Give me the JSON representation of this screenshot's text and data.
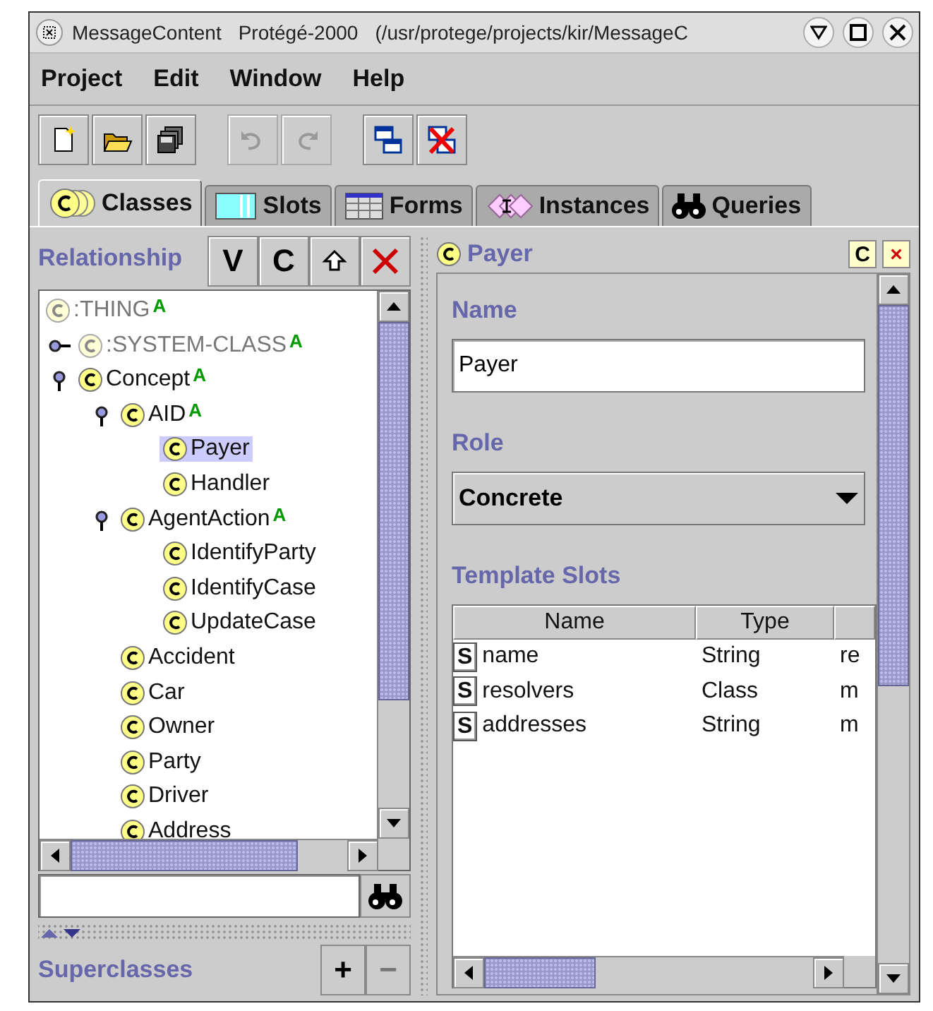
{
  "window": {
    "title_parts": [
      "MessageContent",
      "Protégé-2000",
      "(/usr/protege/projects/kir/MessageC"
    ]
  },
  "menu": [
    "Project",
    "Edit",
    "Window",
    "Help"
  ],
  "toolbar": [
    {
      "kind": "new",
      "disabled": false
    },
    {
      "kind": "open",
      "disabled": false
    },
    {
      "kind": "save",
      "disabled": false
    },
    {
      "kind": "undo",
      "disabled": true
    },
    {
      "kind": "redo",
      "disabled": true
    },
    {
      "kind": "add-window",
      "disabled": false
    },
    {
      "kind": "remove-window",
      "disabled": false
    }
  ],
  "tabs": [
    {
      "label": "Classes",
      "kind": "classes",
      "selected": true
    },
    {
      "label": "Slots",
      "kind": "slots",
      "selected": false
    },
    {
      "label": "Forms",
      "kind": "forms",
      "selected": false
    },
    {
      "label": "Instances",
      "kind": "instances",
      "selected": false
    },
    {
      "label": "Queries",
      "kind": "queries",
      "selected": false
    }
  ],
  "class_browser": {
    "title": "Relationship",
    "buttons": [
      {
        "kind": "text",
        "label": "V"
      },
      {
        "kind": "text",
        "label": "C"
      },
      {
        "kind": "up"
      },
      {
        "kind": "delete"
      }
    ],
    "tree": [
      {
        "name": ":THING",
        "system": true,
        "badge": "A",
        "selected": false,
        "children": [
          {
            "name": ":SYSTEM-CLASS",
            "system": true,
            "badge": "A",
            "selected": false,
            "expanded": false
          },
          {
            "name": "Concept",
            "system": false,
            "badge": "A",
            "selected": false,
            "expanded": true,
            "children": [
              {
                "name": "AID",
                "system": false,
                "badge": "A",
                "selected": false,
                "expanded": true,
                "children": [
                  {
                    "name": "Payer",
                    "system": false,
                    "selected": true
                  },
                  {
                    "name": "Handler",
                    "system": false,
                    "selected": false
                  }
                ]
              },
              {
                "name": "AgentAction",
                "system": false,
                "badge": "A",
                "selected": false,
                "expanded": true,
                "children": [
                  {
                    "name": "IdentifyParty",
                    "system": false,
                    "selected": false
                  },
                  {
                    "name": "IdentifyCase",
                    "system": false,
                    "selected": false
                  },
                  {
                    "name": "UpdateCase",
                    "system": false,
                    "selected": false
                  }
                ]
              },
              {
                "name": "Accident",
                "system": false,
                "selected": false
              },
              {
                "name": "Car",
                "system": false,
                "selected": false
              },
              {
                "name": "Owner",
                "system": false,
                "selected": false
              },
              {
                "name": "Party",
                "system": false,
                "selected": false
              },
              {
                "name": "Driver",
                "system": false,
                "selected": false
              },
              {
                "name": "Address",
                "system": false,
                "selected": false
              }
            ]
          }
        ]
      }
    ],
    "superclasses": {
      "title": "Superclasses",
      "buttons": [
        {
          "label": "+",
          "disabled": false
        },
        {
          "label": "−",
          "disabled": true
        }
      ]
    }
  },
  "class_form": {
    "title": "Payer",
    "buttons": [
      {
        "kind": "text",
        "label": "C"
      },
      {
        "kind": "close",
        "label": "×"
      }
    ],
    "name_label": "Name",
    "name_value": "Payer",
    "role_label": "Role",
    "role_value": "Concrete",
    "slots_label": "Template Slots",
    "columns": [
      "Name",
      "Type"
    ],
    "rows": [
      {
        "icon": "S",
        "name": "name",
        "type": "String",
        "column_3": "re"
      },
      {
        "icon": "S",
        "name": "resolvers",
        "type": "Class",
        "column_3": "m"
      },
      {
        "icon": "S",
        "name": "addresses",
        "type": "String",
        "column_3": "m"
      }
    ]
  }
}
